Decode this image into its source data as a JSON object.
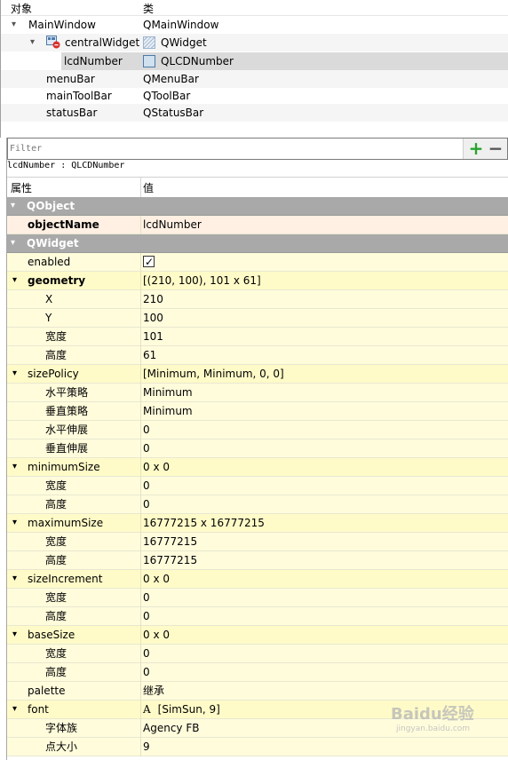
{
  "object_inspector": {
    "headers": {
      "object": "对象",
      "class": "类"
    },
    "rows": [
      {
        "object": "MainWindow",
        "class": "QMainWindow"
      },
      {
        "object": "centralWidget",
        "class": "QWidget"
      },
      {
        "object": "lcdNumber",
        "class": "QLCDNumber"
      },
      {
        "object": "menuBar",
        "class": "QMenuBar"
      },
      {
        "object": "mainToolBar",
        "class": "QToolBar"
      },
      {
        "object": "statusBar",
        "class": "QStatusBar"
      }
    ]
  },
  "filter": {
    "placeholder": "Filter",
    "add": "+",
    "remove": "−"
  },
  "class_label": "lcdNumber : QLCDNumber",
  "property_editor": {
    "headers": {
      "property": "属性",
      "value": "值"
    },
    "groups": {
      "qobject": "QObject",
      "qwidget": "QWidget"
    },
    "rows": {
      "objectName": {
        "key": "objectName",
        "value": "lcdNumber"
      },
      "enabled": {
        "key": "enabled"
      },
      "geometry": {
        "key": "geometry",
        "value": "[(210, 100), 101 x 61]"
      },
      "geo_x": {
        "key": "X",
        "value": "210"
      },
      "geo_y": {
        "key": "Y",
        "value": "100"
      },
      "geo_w": {
        "key": "宽度",
        "value": "101"
      },
      "geo_h": {
        "key": "高度",
        "value": "61"
      },
      "sizePolicy": {
        "key": "sizePolicy",
        "value": "[Minimum, Minimum, 0, 0]"
      },
      "sp_h": {
        "key": "水平策略",
        "value": "Minimum"
      },
      "sp_v": {
        "key": "垂直策略",
        "value": "Minimum"
      },
      "sp_hs": {
        "key": "水平伸展",
        "value": "0"
      },
      "sp_vs": {
        "key": "垂直伸展",
        "value": "0"
      },
      "minimumSize": {
        "key": "minimumSize",
        "value": "0 x 0"
      },
      "min_w": {
        "key": "宽度",
        "value": "0"
      },
      "min_h": {
        "key": "高度",
        "value": "0"
      },
      "maximumSize": {
        "key": "maximumSize",
        "value": "16777215 x 16777215"
      },
      "max_w": {
        "key": "宽度",
        "value": "16777215"
      },
      "max_h": {
        "key": "高度",
        "value": "16777215"
      },
      "sizeIncrement": {
        "key": "sizeIncrement",
        "value": "0 x 0"
      },
      "inc_w": {
        "key": "宽度",
        "value": "0"
      },
      "inc_h": {
        "key": "高度",
        "value": "0"
      },
      "baseSize": {
        "key": "baseSize",
        "value": "0 x 0"
      },
      "base_w": {
        "key": "宽度",
        "value": "0"
      },
      "base_h": {
        "key": "高度",
        "value": "0"
      },
      "palette": {
        "key": "palette",
        "value": "继承"
      },
      "font": {
        "key": "font",
        "value": "[SimSun, 9]",
        "icon_glyph": "A"
      },
      "font_family": {
        "key": "字体族",
        "value": "Agency FB"
      },
      "font_size": {
        "key": "点大小",
        "value": "9"
      }
    }
  },
  "watermark": {
    "brand": "Baidu经验",
    "sub": "jingyan.baidu.com"
  },
  "colors": {
    "group_header": "#a9a9a9",
    "row_yellow": "#fffcdc",
    "row_pink": "#fff0e3",
    "selection": "#dadada",
    "add_green": "#26a42a"
  }
}
